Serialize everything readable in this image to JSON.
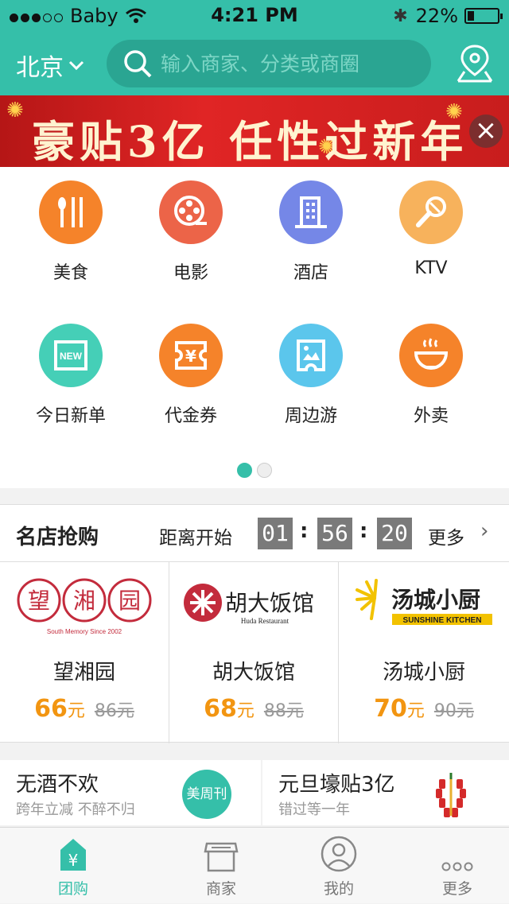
{
  "status": {
    "carrier": "Baby",
    "time": "4:21 PM",
    "battery": "22%",
    "battery_level": 0.22
  },
  "header": {
    "city": "北京",
    "search_placeholder": "输入商家、分类或商圈"
  },
  "banner": {
    "text": "豪贴3亿 任性过新年"
  },
  "categories": [
    {
      "label": "美食",
      "icon": "fork-knife-icon",
      "color": "#f5832a"
    },
    {
      "label": "电影",
      "icon": "film-reel-icon",
      "color": "#ec6448"
    },
    {
      "label": "酒店",
      "icon": "building-icon",
      "color": "#7587e7"
    },
    {
      "label": "KTV",
      "icon": "microphone-icon",
      "color": "#f7b25c"
    },
    {
      "label": "今日新单",
      "icon": "new-badge-icon",
      "color": "#45cfb7"
    },
    {
      "label": "代金券",
      "icon": "yen-ticket-icon",
      "color": "#f5832a"
    },
    {
      "label": "周边游",
      "icon": "travel-ticket-icon",
      "color": "#5bc6ec"
    },
    {
      "label": "外卖",
      "icon": "bowl-icon",
      "color": "#f5832a"
    }
  ],
  "flash_sale": {
    "title": "名店抢购",
    "countdown_label": "距离开始",
    "hours": "01",
    "minutes": "56",
    "seconds": "20",
    "more_label": "更多",
    "shops": [
      {
        "name": "望湘园",
        "price": "66",
        "unit": "元",
        "old_price": "86元",
        "logo_chars": [
          "望",
          "湘",
          "园"
        ],
        "logo_sub": "South Memory Since 2002"
      },
      {
        "name": "胡大饭馆",
        "price": "68",
        "unit": "元",
        "old_price": "88元",
        "logo_text": "胡大饭馆",
        "logo_sub": "Huda Restaurant"
      },
      {
        "name": "汤城小厨",
        "price": "70",
        "unit": "元",
        "old_price": "90元",
        "logo_text": "汤城小厨",
        "logo_sub": "SUNSHINE KITCHEN"
      }
    ]
  },
  "promos": [
    {
      "title": "无酒不欢",
      "subtitle": "跨年立减 不醉不归",
      "badge": "美周刊"
    },
    {
      "title": "元旦壕贴3亿",
      "subtitle": "错过等一年"
    }
  ],
  "tabs": [
    {
      "label": "团购",
      "icon": "yen-bag-icon",
      "active": true
    },
    {
      "label": "商家",
      "icon": "storefront-icon"
    },
    {
      "label": "我的",
      "icon": "user-icon"
    },
    {
      "label": "更多",
      "icon": "ellipsis-icon"
    }
  ],
  "colors": {
    "accent": "#35bfa9",
    "price": "#f29511"
  }
}
